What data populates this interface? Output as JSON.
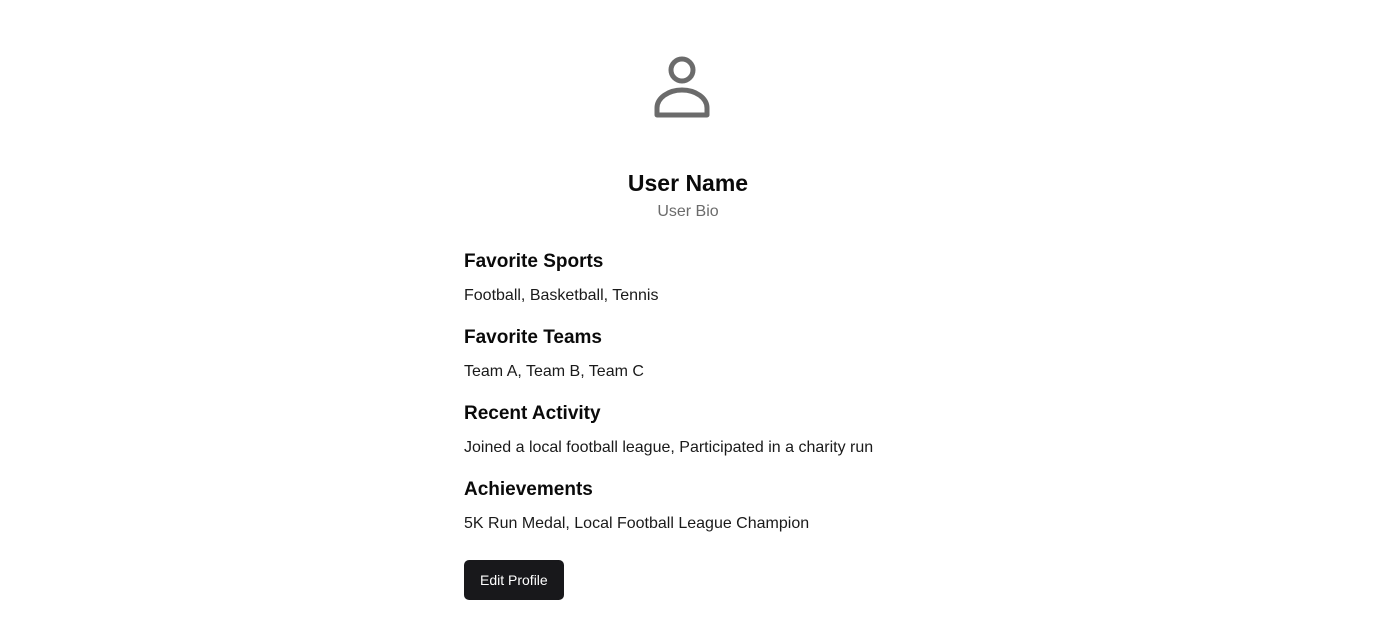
{
  "profile": {
    "avatar_icon": "user-icon",
    "name": "User Name",
    "bio": "User Bio"
  },
  "sections": {
    "favorite_sports": {
      "title": "Favorite Sports",
      "text": "Football, Basketball, Tennis"
    },
    "favorite_teams": {
      "title": "Favorite Teams",
      "text": "Team A, Team B, Team C"
    },
    "recent_activity": {
      "title": "Recent Activity",
      "text": "Joined a local football league, Participated in a charity run"
    },
    "achievements": {
      "title": "Achievements",
      "text": "5K Run Medal, Local Football League Champion"
    }
  },
  "actions": {
    "edit_label": "Edit Profile"
  },
  "colors": {
    "button_bg": "#18181b",
    "icon": "#6b6b6b",
    "muted_text": "#6b6b6b"
  }
}
